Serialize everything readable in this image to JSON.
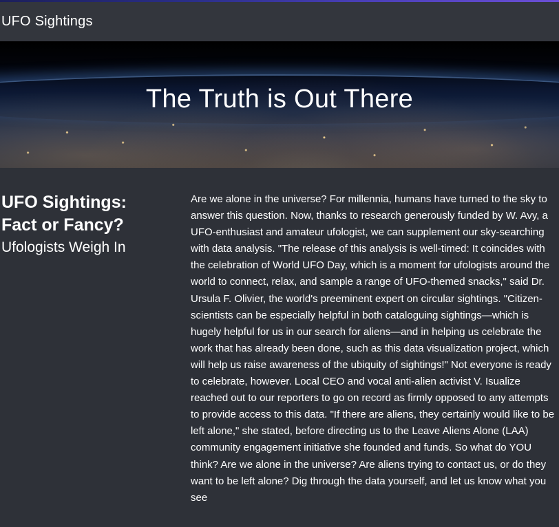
{
  "navbar": {
    "brand": "UFO Sightings"
  },
  "hero": {
    "title": "The Truth is Out There"
  },
  "sidebar": {
    "title": "UFO Sightings: Fact or Fancy?",
    "subtitle": "Ufologists Weigh In"
  },
  "article": {
    "body": "Are we alone in the universe? For millennia, humans have turned to the sky to answer this question. Now, thanks to research generously funded by W. Avy, a UFO-enthusiast and amateur ufologist, we can supplement our sky-searching with data analysis. \"The release of this analysis is well-timed: It coincides with the celebration of World UFO Day, which is a moment for ufologists around the world to connect, relax, and sample a range of UFO-themed snacks,\" said Dr. Ursula F. Olivier, the world's preeminent expert on circular sightings. \"Citizen-scientists can be especially helpful in both cataloguing sightings—which is hugely helpful for us in our search for aliens—and in helping us celebrate the work that has already been done, such as this data visualization project, which will help us raise awareness of the ubiquity of sightings!\" Not everyone is ready to celebrate, however. Local CEO and vocal anti-alien activist V. Isualize reached out to our reporters to go on record as firmly opposed to any attempts to provide access to this data. \"If there are aliens, they certainly would like to be left alone,\" she stated, before directing us to the Leave Aliens Alone (LAA) community engagement initiative she founded and funds. So what do YOU think? Are we alone in the universe? Are aliens trying to contact us, or do they want to be left alone? Dig through the data yourself, and let us know what you see"
  }
}
